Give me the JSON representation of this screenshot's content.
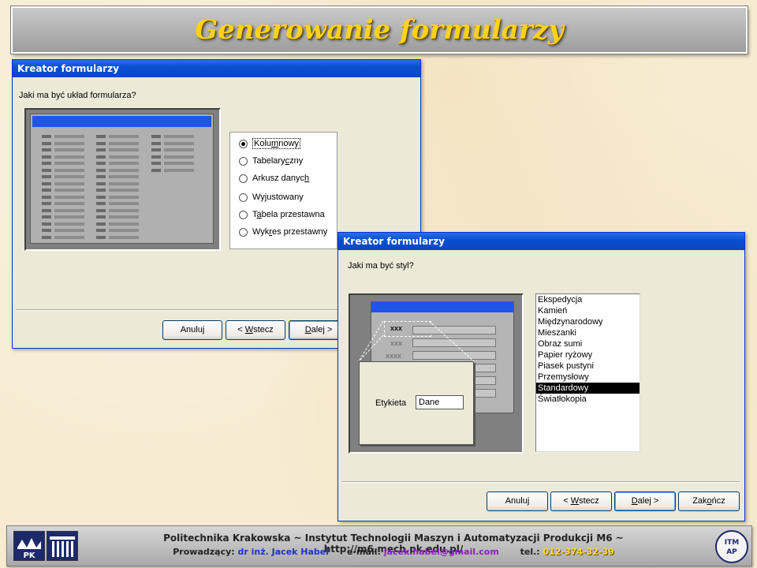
{
  "slide": {
    "title": "Generowanie formularzy"
  },
  "dialog1": {
    "title": "Kreator formularzy",
    "question": "Jaki ma być układ formularza?",
    "options": [
      {
        "pre": "Kolu",
        "acc": "m",
        "post": "nowy",
        "checked": true
      },
      {
        "pre": "Tabelary",
        "acc": "c",
        "post": "zny",
        "checked": false
      },
      {
        "pre": "Arkusz danyc",
        "acc": "h",
        "post": "",
        "checked": false
      },
      {
        "pre": "Wy",
        "acc": "j",
        "post": "ustowany",
        "checked": false
      },
      {
        "pre": "T",
        "acc": "a",
        "post": "bela przestawna",
        "checked": false
      },
      {
        "pre": "Wyk",
        "acc": "r",
        "post": "es przestawny",
        "checked": false
      }
    ],
    "buttons": {
      "cancel": "Anuluj",
      "back_pre": "< ",
      "back_acc": "W",
      "back_post": "stecz",
      "next_pre": "",
      "next_acc": "D",
      "next_post": "alej >"
    }
  },
  "dialog2": {
    "title": "Kreator formularzy",
    "question": "Jaki ma być styl?",
    "preview": {
      "label_rows": [
        "xxx",
        "xxx",
        "xxxx"
      ],
      "zoom_label": "Etykieta",
      "zoom_value": "Dane"
    },
    "styles": [
      "Ekspedycja",
      "Kamień",
      "Międzynarodowy",
      "Mieszanki",
      "Obraz sumi",
      "Papier ryżowy",
      "Piasek pustyni",
      "Przemysłowy",
      "Standardowy",
      "Światłokopia"
    ],
    "selected_style": "Standardowy",
    "buttons": {
      "cancel": "Anuluj",
      "back_pre": "< ",
      "back_acc": "W",
      "back_post": "stecz",
      "next_pre": "",
      "next_acc": "D",
      "next_post": "alej >",
      "finish_pre": "Zak",
      "finish_acc": "o",
      "finish_post": "ńcz"
    }
  },
  "footer": {
    "line1": "Politechnika Krakowska   ~   Instytut Technologii Maszyn i Automatyzacji Produkcji M6   ~   http://m6.mech.pk.edu.pl/",
    "lecturer_label": "Prowadzący:",
    "lecturer_name": "dr inż. Jacek Habel",
    "email_label": "e-mail:",
    "email": "jacek.habel@gmail.com",
    "phone_label": "tel.:",
    "phone": "012-374-32-39",
    "logo_left_text": "PK",
    "logo_right_text": "ITM AP"
  },
  "colors": {
    "title": "#ffd21a",
    "titlebar": "#0a4fd2",
    "email": "#8a1fbf",
    "lecturer": "#1f2fd4",
    "phone": "#ffe21a"
  }
}
